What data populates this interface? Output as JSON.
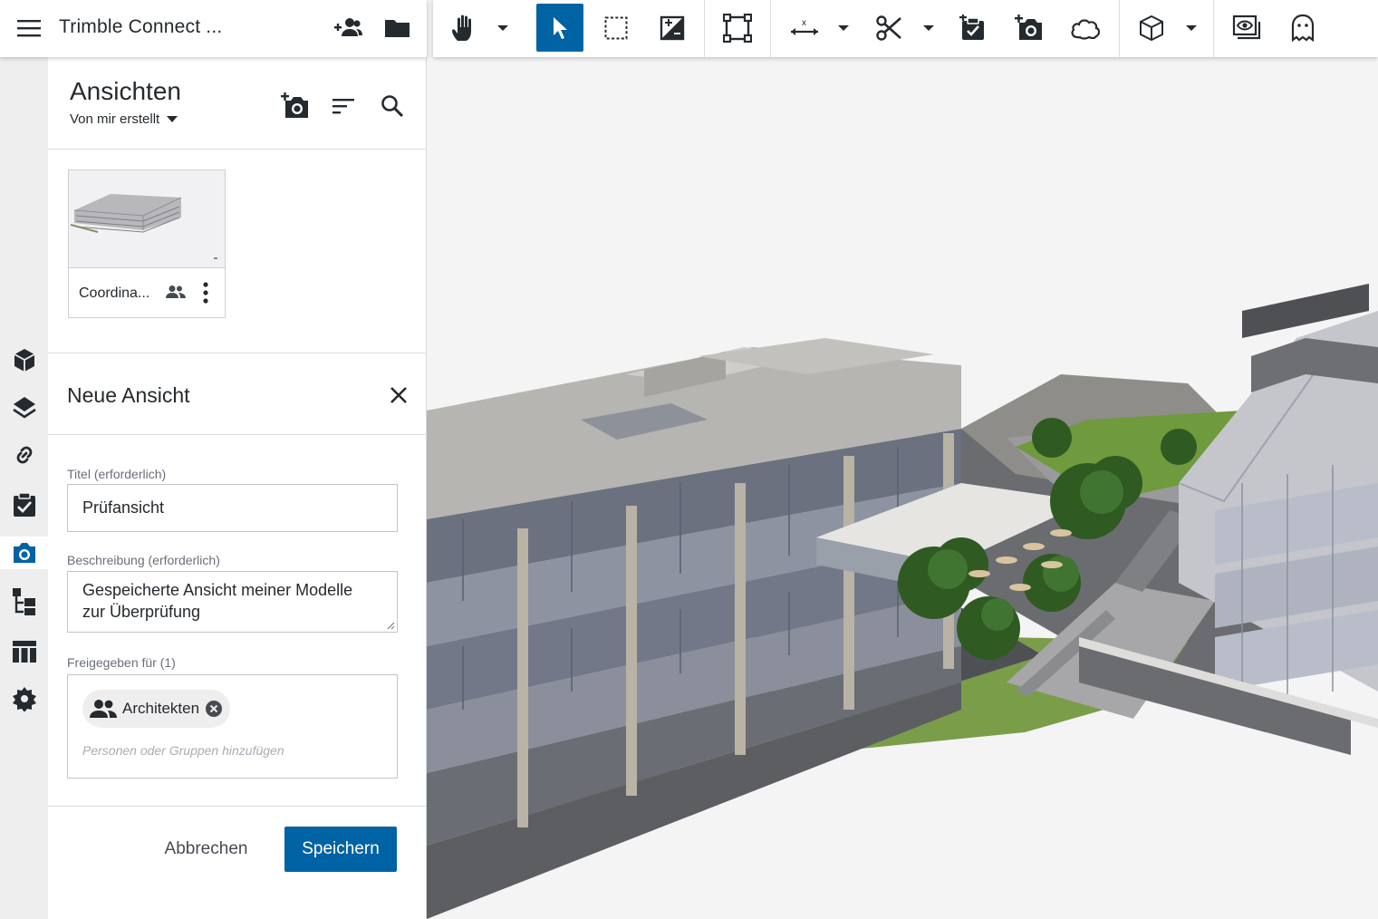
{
  "app": {
    "title": "Trimble Connect ...",
    "icons": [
      "menu-icon",
      "add-user-icon",
      "folder-icon"
    ]
  },
  "toolbar": {
    "tools": [
      "hand-pan-icon",
      "select-arrow-icon",
      "selection-box-icon",
      "edit-image-icon",
      "fit-frame-icon",
      "measure-icon",
      "section-scissors-icon",
      "todo-add-icon",
      "add-view-camera-icon",
      "markup-cloud-icon",
      "cube-view-icon",
      "show-hide-eye-icon",
      "ghost-icon"
    ],
    "active": "select-arrow-icon",
    "accent_color": "#0063a3"
  },
  "rail": {
    "items": [
      "models-cube-icon",
      "layers-icon",
      "link-icon",
      "todo-check-icon",
      "views-camera-icon",
      "tree-structure-icon",
      "table-icon",
      "extensions-icon"
    ],
    "active": "views-camera-icon"
  },
  "panel": {
    "title": "Ansichten",
    "filter": "Von mir erstellt",
    "views": [
      {
        "name": "Coordina...",
        "shared": true
      }
    ],
    "new_view": {
      "heading": "Neue Ansicht",
      "title_label": "Titel (erforderlich)",
      "title_value": "Prüfansicht",
      "description_label": "Beschreibung (erforderlich)",
      "description_line1": "Gespeicherte Ansicht meiner Modelle",
      "description_line2": "zur Überprüfung",
      "shared_label": "Freigegeben für (1)",
      "shared_chip": "Architekten",
      "add_placeholder": "Personen oder Gruppen hinzufügen",
      "cancel_label": "Abbrechen",
      "save_label": "Speichern"
    }
  }
}
